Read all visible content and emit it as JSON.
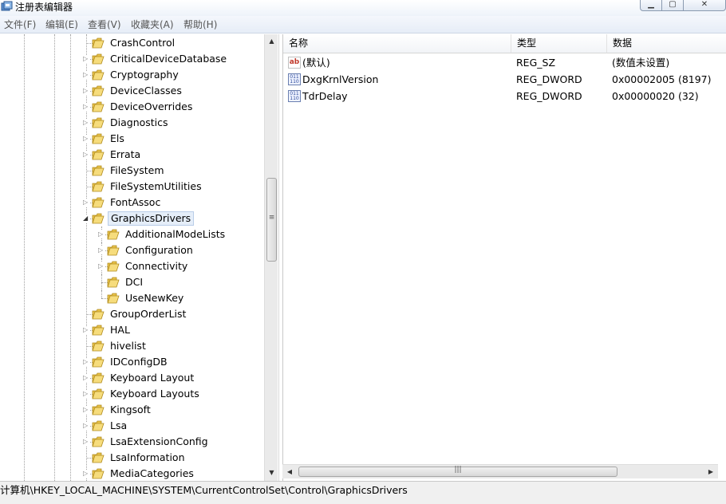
{
  "window": {
    "title": "注册表编辑器",
    "min_glyph": "▁",
    "max_glyph": "▢",
    "close_glyph": "✕"
  },
  "menu": [
    "文件(F)",
    "编辑(E)",
    "查看(V)",
    "收藏夹(A)",
    "帮助(H)"
  ],
  "tree": {
    "items": [
      {
        "label": "CrashControl",
        "level": 0,
        "expandable": false
      },
      {
        "label": "CriticalDeviceDatabase",
        "level": 0,
        "expandable": true
      },
      {
        "label": "Cryptography",
        "level": 0,
        "expandable": true
      },
      {
        "label": "DeviceClasses",
        "level": 0,
        "expandable": true
      },
      {
        "label": "DeviceOverrides",
        "level": 0,
        "expandable": true
      },
      {
        "label": "Diagnostics",
        "level": 0,
        "expandable": true
      },
      {
        "label": "Els",
        "level": 0,
        "expandable": true
      },
      {
        "label": "Errata",
        "level": 0,
        "expandable": true
      },
      {
        "label": "FileSystem",
        "level": 0,
        "expandable": false
      },
      {
        "label": "FileSystemUtilities",
        "level": 0,
        "expandable": false
      },
      {
        "label": "FontAssoc",
        "level": 0,
        "expandable": true
      },
      {
        "label": "GraphicsDrivers",
        "level": 0,
        "expandable": true,
        "expanded": true,
        "selected": true
      },
      {
        "label": "AdditionalModeLists",
        "level": 1,
        "expandable": true
      },
      {
        "label": "Configuration",
        "level": 1,
        "expandable": true
      },
      {
        "label": "Connectivity",
        "level": 1,
        "expandable": true
      },
      {
        "label": "DCI",
        "level": 1,
        "expandable": false
      },
      {
        "label": "UseNewKey",
        "level": 1,
        "expandable": false
      },
      {
        "label": "GroupOrderList",
        "level": 0,
        "expandable": false
      },
      {
        "label": "HAL",
        "level": 0,
        "expandable": true
      },
      {
        "label": "hivelist",
        "level": 0,
        "expandable": false
      },
      {
        "label": "IDConfigDB",
        "level": 0,
        "expandable": true
      },
      {
        "label": "Keyboard Layout",
        "level": 0,
        "expandable": true
      },
      {
        "label": "Keyboard Layouts",
        "level": 0,
        "expandable": true
      },
      {
        "label": "Kingsoft",
        "level": 0,
        "expandable": true
      },
      {
        "label": "Lsa",
        "level": 0,
        "expandable": true
      },
      {
        "label": "LsaExtensionConfig",
        "level": 0,
        "expandable": true
      },
      {
        "label": "LsaInformation",
        "level": 0,
        "expandable": false
      },
      {
        "label": "MediaCategories",
        "level": 0,
        "expandable": true
      }
    ]
  },
  "list": {
    "columns": [
      "名称",
      "类型",
      "数据"
    ],
    "rows": [
      {
        "icon": "string-value-icon",
        "name": "(默认)",
        "type": "REG_SZ",
        "data": "(数值未设置)"
      },
      {
        "icon": "binary-value-icon",
        "name": "DxgKrnlVersion",
        "type": "REG_DWORD",
        "data": "0x00002005 (8197)"
      },
      {
        "icon": "binary-value-icon",
        "name": "TdrDelay",
        "type": "REG_DWORD",
        "data": "0x00000020 (32)"
      }
    ]
  },
  "status": {
    "path": "计算机\\HKEY_LOCAL_MACHINE\\SYSTEM\\CurrentControlSet\\Control\\GraphicsDrivers"
  },
  "colors": {
    "folder": "#e8c24a",
    "selection": "#e5eef9"
  }
}
